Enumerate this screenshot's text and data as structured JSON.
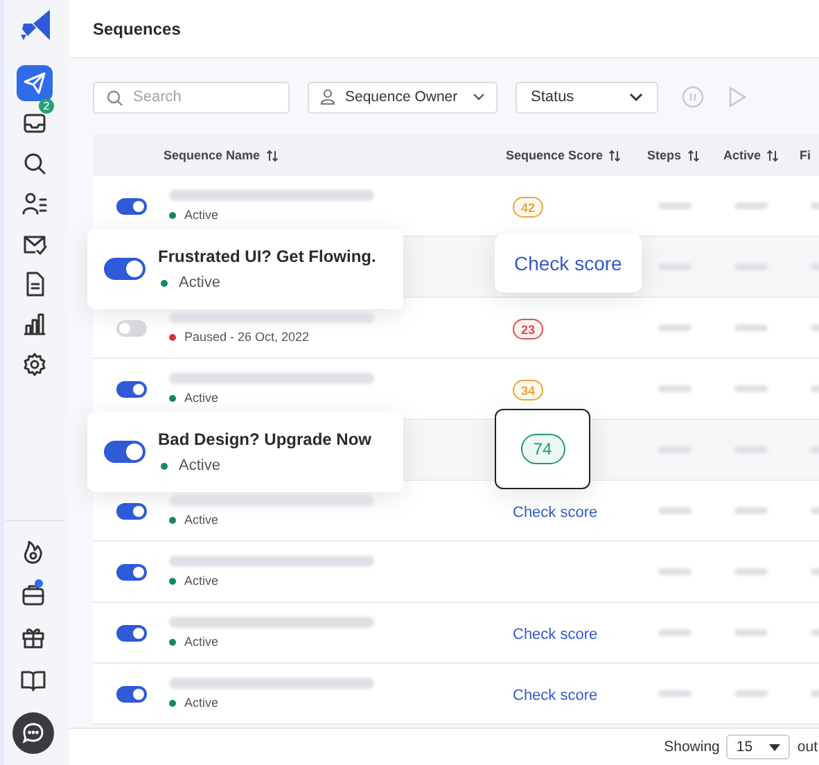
{
  "page": {
    "title": "Sequences"
  },
  "sidebar": {
    "items": [
      {
        "selected": true
      },
      {
        "selected": false,
        "badge": "2"
      },
      {
        "selected": false
      },
      {
        "selected": false
      },
      {
        "selected": false
      },
      {
        "selected": false
      },
      {
        "selected": false
      },
      {
        "selected": false
      }
    ],
    "bottom_items": [
      {
        "dot": false
      },
      {
        "dot": true
      },
      {
        "dot": false
      },
      {
        "dot": false
      }
    ]
  },
  "toolbar": {
    "search": {
      "placeholder": "Search"
    },
    "owner_filter": "Sequence Owner",
    "status_filter": "Status",
    "pause_disabled": true
  },
  "table": {
    "columns": [
      "Sequence Name",
      "Sequence Score",
      "Steps",
      "Active",
      "Fi"
    ],
    "rows": [
      {
        "on": true,
        "status": {
          "text": "Active",
          "color": "#138a63"
        },
        "score": {
          "kind": "badge",
          "text": "42",
          "color": "#e6a83a"
        }
      },
      {
        "on": true,
        "floating": true,
        "name": "Frustrated UI? Get Flowing.",
        "status": {
          "text": "Active",
          "color": "#138a63"
        },
        "score": {
          "kind": "link",
          "text": "Check score"
        }
      },
      {
        "on": false,
        "status": {
          "text": "Paused - 26 Oct, 2022",
          "color": "#d03838"
        },
        "score": {
          "kind": "badge",
          "text": "23",
          "color": "#d9534f"
        }
      },
      {
        "on": true,
        "status": {
          "text": "Active",
          "color": "#138a63"
        },
        "score": {
          "kind": "badge",
          "text": "34",
          "color": "#e6a83a"
        }
      },
      {
        "on": true,
        "floating": true,
        "name": "Bad Design? Upgrade Now",
        "status": {
          "text": "Active",
          "color": "#138a63"
        },
        "score": {
          "kind": "badge",
          "text": "74",
          "color": "#1f9a72"
        }
      },
      {
        "on": true,
        "status": {
          "text": "Active",
          "color": "#138a63"
        },
        "score": {
          "kind": "link",
          "text": "Check score"
        }
      },
      {
        "on": true,
        "status": {
          "text": "Active",
          "color": "#138a63"
        }
      },
      {
        "on": true,
        "status": {
          "text": "Active",
          "color": "#138a63"
        },
        "score": {
          "kind": "link",
          "text": "Check score"
        }
      },
      {
        "on": true,
        "status": {
          "text": "Active",
          "color": "#138a63"
        },
        "score": {
          "kind": "link",
          "text": "Check score"
        }
      }
    ]
  },
  "footer": {
    "label": "Showing",
    "page_size": "15",
    "trailing": "out"
  }
}
